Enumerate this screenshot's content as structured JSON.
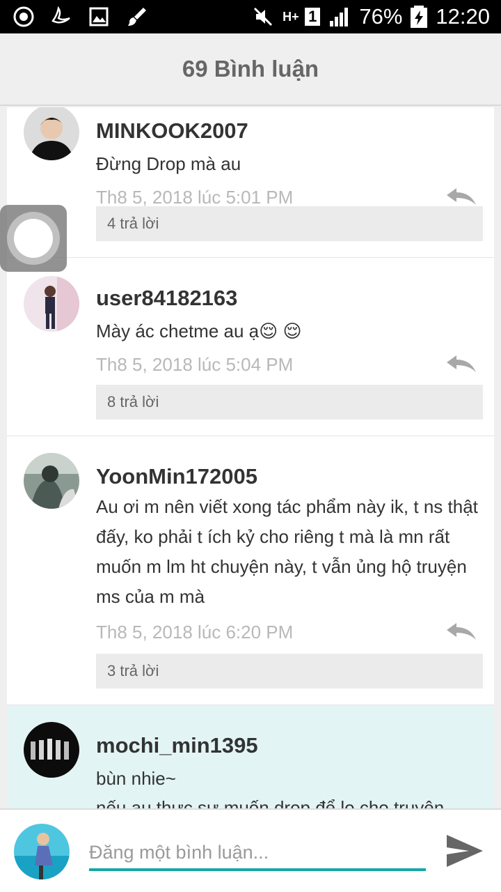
{
  "status_bar": {
    "network": "H+",
    "sim": "1",
    "battery": "76%",
    "time": "12:20"
  },
  "header": {
    "title": "69 Bình luận"
  },
  "comments": [
    {
      "username": "MINKOOK2007",
      "text": "Đừng Drop mà au",
      "time": "Th8 5, 2018 lúc 5:01 PM",
      "replies": "4 trả lời"
    },
    {
      "username": "user84182163",
      "text": "Mày ác chetme au ạ😌 😌",
      "time": "Th8 5, 2018 lúc 5:04 PM",
      "replies": "8 trả lời"
    },
    {
      "username": "YoonMin172005",
      "text": "Au ơi m nên viết xong tác phẩm này ik, t ns thật đấy, ko phải t ích kỷ cho riêng t mà là mn rất muốn m lm ht chuyện này, t vẫn ủng hộ truyện ms của m mà",
      "time": "Th8 5, 2018 lúc 6:20 PM",
      "replies": "3 trả lời"
    },
    {
      "username": "mochi_min1395",
      "text": "bùn nhie~",
      "text2": "nếu au thực sự muốn drop để lo cho truyện"
    }
  ],
  "composer": {
    "placeholder": "Đăng một bình luận..."
  },
  "colors": {
    "accent": "#17a7a5",
    "highlight_bg": "#e3f4f5"
  }
}
